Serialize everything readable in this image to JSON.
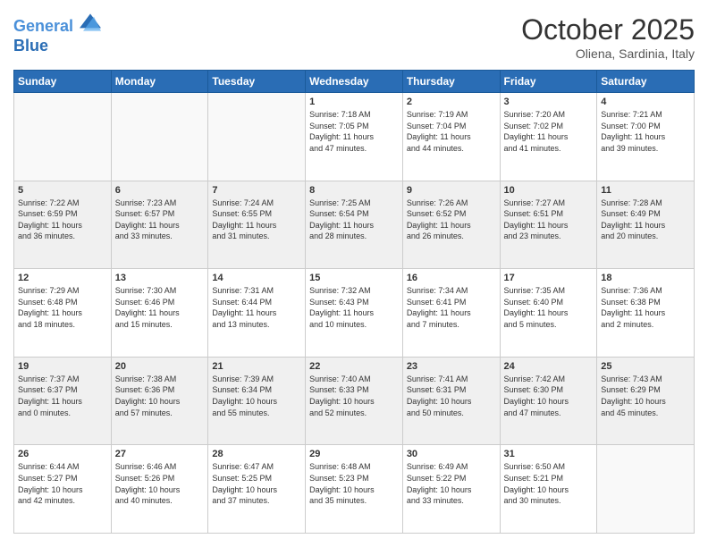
{
  "header": {
    "logo_line1": "General",
    "logo_line2": "Blue",
    "month": "October 2025",
    "location": "Oliena, Sardinia, Italy"
  },
  "days_of_week": [
    "Sunday",
    "Monday",
    "Tuesday",
    "Wednesday",
    "Thursday",
    "Friday",
    "Saturday"
  ],
  "weeks": [
    {
      "shaded": false,
      "days": [
        {
          "num": "",
          "info": ""
        },
        {
          "num": "",
          "info": ""
        },
        {
          "num": "",
          "info": ""
        },
        {
          "num": "1",
          "info": "Sunrise: 7:18 AM\nSunset: 7:05 PM\nDaylight: 11 hours\nand 47 minutes."
        },
        {
          "num": "2",
          "info": "Sunrise: 7:19 AM\nSunset: 7:04 PM\nDaylight: 11 hours\nand 44 minutes."
        },
        {
          "num": "3",
          "info": "Sunrise: 7:20 AM\nSunset: 7:02 PM\nDaylight: 11 hours\nand 41 minutes."
        },
        {
          "num": "4",
          "info": "Sunrise: 7:21 AM\nSunset: 7:00 PM\nDaylight: 11 hours\nand 39 minutes."
        }
      ]
    },
    {
      "shaded": true,
      "days": [
        {
          "num": "5",
          "info": "Sunrise: 7:22 AM\nSunset: 6:59 PM\nDaylight: 11 hours\nand 36 minutes."
        },
        {
          "num": "6",
          "info": "Sunrise: 7:23 AM\nSunset: 6:57 PM\nDaylight: 11 hours\nand 33 minutes."
        },
        {
          "num": "7",
          "info": "Sunrise: 7:24 AM\nSunset: 6:55 PM\nDaylight: 11 hours\nand 31 minutes."
        },
        {
          "num": "8",
          "info": "Sunrise: 7:25 AM\nSunset: 6:54 PM\nDaylight: 11 hours\nand 28 minutes."
        },
        {
          "num": "9",
          "info": "Sunrise: 7:26 AM\nSunset: 6:52 PM\nDaylight: 11 hours\nand 26 minutes."
        },
        {
          "num": "10",
          "info": "Sunrise: 7:27 AM\nSunset: 6:51 PM\nDaylight: 11 hours\nand 23 minutes."
        },
        {
          "num": "11",
          "info": "Sunrise: 7:28 AM\nSunset: 6:49 PM\nDaylight: 11 hours\nand 20 minutes."
        }
      ]
    },
    {
      "shaded": false,
      "days": [
        {
          "num": "12",
          "info": "Sunrise: 7:29 AM\nSunset: 6:48 PM\nDaylight: 11 hours\nand 18 minutes."
        },
        {
          "num": "13",
          "info": "Sunrise: 7:30 AM\nSunset: 6:46 PM\nDaylight: 11 hours\nand 15 minutes."
        },
        {
          "num": "14",
          "info": "Sunrise: 7:31 AM\nSunset: 6:44 PM\nDaylight: 11 hours\nand 13 minutes."
        },
        {
          "num": "15",
          "info": "Sunrise: 7:32 AM\nSunset: 6:43 PM\nDaylight: 11 hours\nand 10 minutes."
        },
        {
          "num": "16",
          "info": "Sunrise: 7:34 AM\nSunset: 6:41 PM\nDaylight: 11 hours\nand 7 minutes."
        },
        {
          "num": "17",
          "info": "Sunrise: 7:35 AM\nSunset: 6:40 PM\nDaylight: 11 hours\nand 5 minutes."
        },
        {
          "num": "18",
          "info": "Sunrise: 7:36 AM\nSunset: 6:38 PM\nDaylight: 11 hours\nand 2 minutes."
        }
      ]
    },
    {
      "shaded": true,
      "days": [
        {
          "num": "19",
          "info": "Sunrise: 7:37 AM\nSunset: 6:37 PM\nDaylight: 11 hours\nand 0 minutes."
        },
        {
          "num": "20",
          "info": "Sunrise: 7:38 AM\nSunset: 6:36 PM\nDaylight: 10 hours\nand 57 minutes."
        },
        {
          "num": "21",
          "info": "Sunrise: 7:39 AM\nSunset: 6:34 PM\nDaylight: 10 hours\nand 55 minutes."
        },
        {
          "num": "22",
          "info": "Sunrise: 7:40 AM\nSunset: 6:33 PM\nDaylight: 10 hours\nand 52 minutes."
        },
        {
          "num": "23",
          "info": "Sunrise: 7:41 AM\nSunset: 6:31 PM\nDaylight: 10 hours\nand 50 minutes."
        },
        {
          "num": "24",
          "info": "Sunrise: 7:42 AM\nSunset: 6:30 PM\nDaylight: 10 hours\nand 47 minutes."
        },
        {
          "num": "25",
          "info": "Sunrise: 7:43 AM\nSunset: 6:29 PM\nDaylight: 10 hours\nand 45 minutes."
        }
      ]
    },
    {
      "shaded": false,
      "days": [
        {
          "num": "26",
          "info": "Sunrise: 6:44 AM\nSunset: 5:27 PM\nDaylight: 10 hours\nand 42 minutes."
        },
        {
          "num": "27",
          "info": "Sunrise: 6:46 AM\nSunset: 5:26 PM\nDaylight: 10 hours\nand 40 minutes."
        },
        {
          "num": "28",
          "info": "Sunrise: 6:47 AM\nSunset: 5:25 PM\nDaylight: 10 hours\nand 37 minutes."
        },
        {
          "num": "29",
          "info": "Sunrise: 6:48 AM\nSunset: 5:23 PM\nDaylight: 10 hours\nand 35 minutes."
        },
        {
          "num": "30",
          "info": "Sunrise: 6:49 AM\nSunset: 5:22 PM\nDaylight: 10 hours\nand 33 minutes."
        },
        {
          "num": "31",
          "info": "Sunrise: 6:50 AM\nSunset: 5:21 PM\nDaylight: 10 hours\nand 30 minutes."
        },
        {
          "num": "",
          "info": ""
        }
      ]
    }
  ]
}
